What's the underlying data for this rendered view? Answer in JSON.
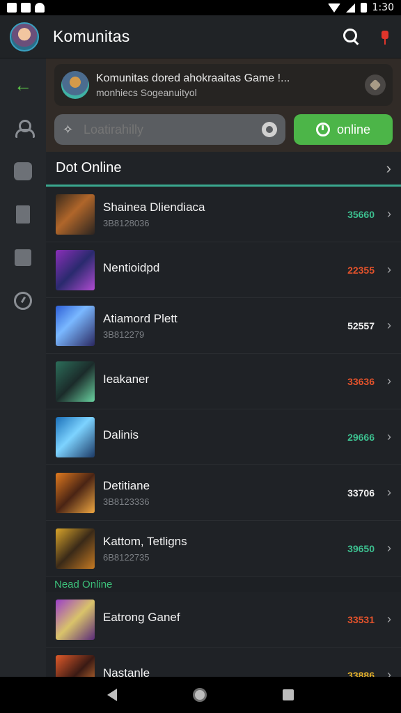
{
  "status_bar": {
    "time": "1:30"
  },
  "app_bar": {
    "title": "Komunitas"
  },
  "notification": {
    "title": "Komunitas dored ahokraaitas Game !...",
    "subtitle": "monhiecs Sogeanuityol"
  },
  "filter": {
    "placeholder": "Loatirahilly",
    "online_label": "online"
  },
  "section": {
    "title": "Dot Online"
  },
  "games_online": [
    {
      "name": "Shainea Dliendiaca",
      "sub": "3B8128036",
      "score": "35660",
      "score_color": "#3cbf8f",
      "thumb": "linear-gradient(135deg,#3a2a1c,#b0662a 45%,#2b2420)"
    },
    {
      "name": "Nentioidpd",
      "sub": "",
      "score": "22355",
      "score_color": "#e2522b",
      "thumb": "linear-gradient(135deg,#8a2fb8,#2a2a6e 50%,#b04bd1)"
    },
    {
      "name": "Atiamord Plett",
      "sub": "3B812279",
      "score": "52557",
      "score_color": "#f0f0f0",
      "thumb": "linear-gradient(135deg,#2d5fd6,#7ab8ff 40%,#2a2860)"
    },
    {
      "name": "Ieakaner",
      "sub": "",
      "score": "33636",
      "score_color": "#e2522b",
      "thumb": "linear-gradient(135deg,#2c6e5a,#1b2b2a 50%,#6ad3a1)"
    },
    {
      "name": "Dalinis",
      "sub": "",
      "score": "29666",
      "score_color": "#3cbf8f",
      "thumb": "linear-gradient(135deg,#1a6fb8,#7dd3ff 45%,#1c3a66)"
    },
    {
      "name": "Detitiane",
      "sub": "3B8123336",
      "score": "33706",
      "score_color": "#f0f0f0",
      "thumb": "linear-gradient(135deg,#e07a1f,#4a2414 50%,#f0a842)"
    },
    {
      "name": "Kattom, Tetligns",
      "sub": "6B8122735",
      "score": "39650",
      "score_color": "#3cbf8f",
      "thumb": "linear-gradient(135deg,#d9a52b,#3a2a18 50%,#c57a23)"
    }
  ],
  "sub_section": {
    "title": "Nead Online"
  },
  "games_other": [
    {
      "name": "Eatrong Ganef",
      "sub": "",
      "score": "33531",
      "score_color": "#e2522b",
      "thumb": "linear-gradient(135deg,#9b3ec9,#d9c36a 50%,#5a2a7a)"
    },
    {
      "name": "Nastanle",
      "sub": "",
      "score": "33886",
      "score_color": "#e3b02a",
      "thumb": "linear-gradient(135deg,#e05a2a,#3a1a14 50%,#f08a3a)"
    }
  ]
}
